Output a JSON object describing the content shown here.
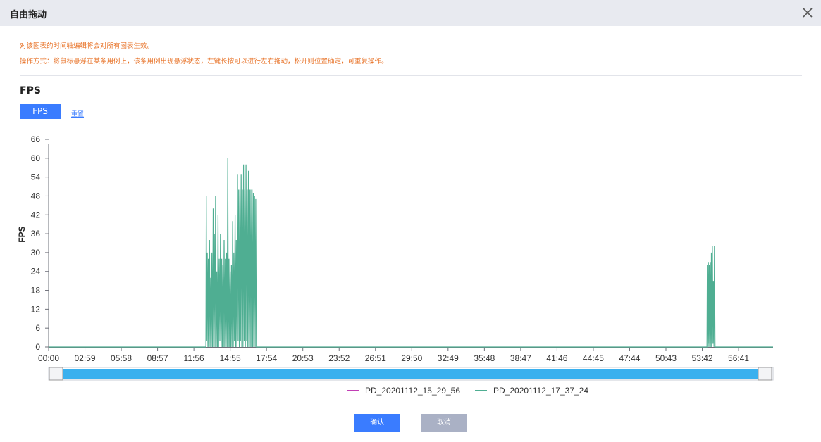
{
  "dialog": {
    "title": "自由拖动",
    "close_icon": "close-icon"
  },
  "notes": {
    "line1": "对该图表的时间轴编辑将会对所有图表生效。",
    "line2": "操作方式：将鼠标悬浮在某条用例上，该条用例出现悬浮状态，左键长按可以进行左右拖动，松开则位置确定，可重复操作。"
  },
  "section_title": "FPS",
  "tabs": {
    "fps_label": "FPS",
    "reset_label": "重置"
  },
  "footer": {
    "confirm_label": "确认",
    "cancel_label": "取消"
  },
  "colors": {
    "accent": "#3a7cff",
    "slider": "#3ab0ee",
    "series_1": "#c23fb5",
    "series_2": "#4fae92",
    "notes": "#e8742a"
  },
  "chart_data": {
    "type": "line",
    "ylabel": "FPS",
    "xlabel": "",
    "ylim": [
      0,
      66
    ],
    "yticks": [
      0,
      6,
      12,
      18,
      24,
      30,
      36,
      42,
      48,
      54,
      60,
      66
    ],
    "xticks": [
      "00:00",
      "02:59",
      "05:58",
      "08:57",
      "11:56",
      "14:55",
      "17:54",
      "20:53",
      "23:52",
      "26:51",
      "29:50",
      "32:49",
      "35:48",
      "38:47",
      "41:46",
      "44:45",
      "47:44",
      "50:43",
      "53:42",
      "56:41"
    ],
    "xlim_seconds": [
      0,
      3571
    ],
    "zoom_range": [
      0,
      1
    ],
    "grid": false,
    "legend_position": "bottom-center",
    "series": [
      {
        "name": "PD_20201112_15_29_56",
        "color": "#c23fb5",
        "points": []
      },
      {
        "name": "PD_20201112_17_37_24",
        "color": "#4fae92",
        "points": [
          [
            0,
            0
          ],
          [
            775,
            0
          ],
          [
            777,
            48
          ],
          [
            779,
            2
          ],
          [
            782,
            30
          ],
          [
            785,
            0
          ],
          [
            787,
            28
          ],
          [
            790,
            0
          ],
          [
            793,
            34
          ],
          [
            796,
            0
          ],
          [
            799,
            22
          ],
          [
            802,
            0
          ],
          [
            805,
            30
          ],
          [
            808,
            0
          ],
          [
            811,
            44
          ],
          [
            814,
            0
          ],
          [
            817,
            36
          ],
          [
            820,
            0
          ],
          [
            823,
            48
          ],
          [
            826,
            0
          ],
          [
            829,
            24
          ],
          [
            832,
            0
          ],
          [
            835,
            42
          ],
          [
            838,
            0
          ],
          [
            841,
            28
          ],
          [
            844,
            2
          ],
          [
            847,
            36
          ],
          [
            850,
            0
          ],
          [
            853,
            28
          ],
          [
            856,
            0
          ],
          [
            859,
            26
          ],
          [
            862,
            0
          ],
          [
            865,
            34
          ],
          [
            868,
            0
          ],
          [
            871,
            28
          ],
          [
            874,
            0
          ],
          [
            877,
            30
          ],
          [
            880,
            0
          ],
          [
            883,
            60
          ],
          [
            886,
            0
          ],
          [
            889,
            28
          ],
          [
            892,
            0
          ],
          [
            895,
            24
          ],
          [
            898,
            0
          ],
          [
            901,
            26
          ],
          [
            904,
            0
          ],
          [
            907,
            40
          ],
          [
            910,
            0
          ],
          [
            913,
            30
          ],
          [
            916,
            2
          ],
          [
            919,
            42
          ],
          [
            922,
            0
          ],
          [
            925,
            34
          ],
          [
            928,
            0
          ],
          [
            931,
            55
          ],
          [
            934,
            2
          ],
          [
            937,
            50
          ],
          [
            940,
            0
          ],
          [
            943,
            50
          ],
          [
            946,
            2
          ],
          [
            949,
            55
          ],
          [
            952,
            0
          ],
          [
            955,
            50
          ],
          [
            958,
            0
          ],
          [
            961,
            58
          ],
          [
            964,
            2
          ],
          [
            967,
            50
          ],
          [
            970,
            0
          ],
          [
            973,
            58
          ],
          [
            976,
            2
          ],
          [
            979,
            50
          ],
          [
            982,
            0
          ],
          [
            985,
            56
          ],
          [
            988,
            0
          ],
          [
            991,
            50
          ],
          [
            994,
            0
          ],
          [
            997,
            50
          ],
          [
            1000,
            0
          ],
          [
            1003,
            50
          ],
          [
            1006,
            0
          ],
          [
            1009,
            49
          ],
          [
            1012,
            0
          ],
          [
            1015,
            48
          ],
          [
            1018,
            0
          ],
          [
            1021,
            47
          ],
          [
            1024,
            0
          ],
          [
            1027,
            0
          ],
          [
            3245,
            0
          ],
          [
            3247,
            26
          ],
          [
            3250,
            1
          ],
          [
            3252,
            27
          ],
          [
            3255,
            0
          ],
          [
            3257,
            26
          ],
          [
            3260,
            1
          ],
          [
            3262,
            27
          ],
          [
            3265,
            0
          ],
          [
            3267,
            30
          ],
          [
            3270,
            0
          ],
          [
            3272,
            32
          ],
          [
            3275,
            1
          ],
          [
            3277,
            21
          ],
          [
            3280,
            0
          ],
          [
            3282,
            32
          ],
          [
            3285,
            0
          ],
          [
            3287,
            0
          ],
          [
            3571,
            0
          ]
        ]
      }
    ]
  }
}
